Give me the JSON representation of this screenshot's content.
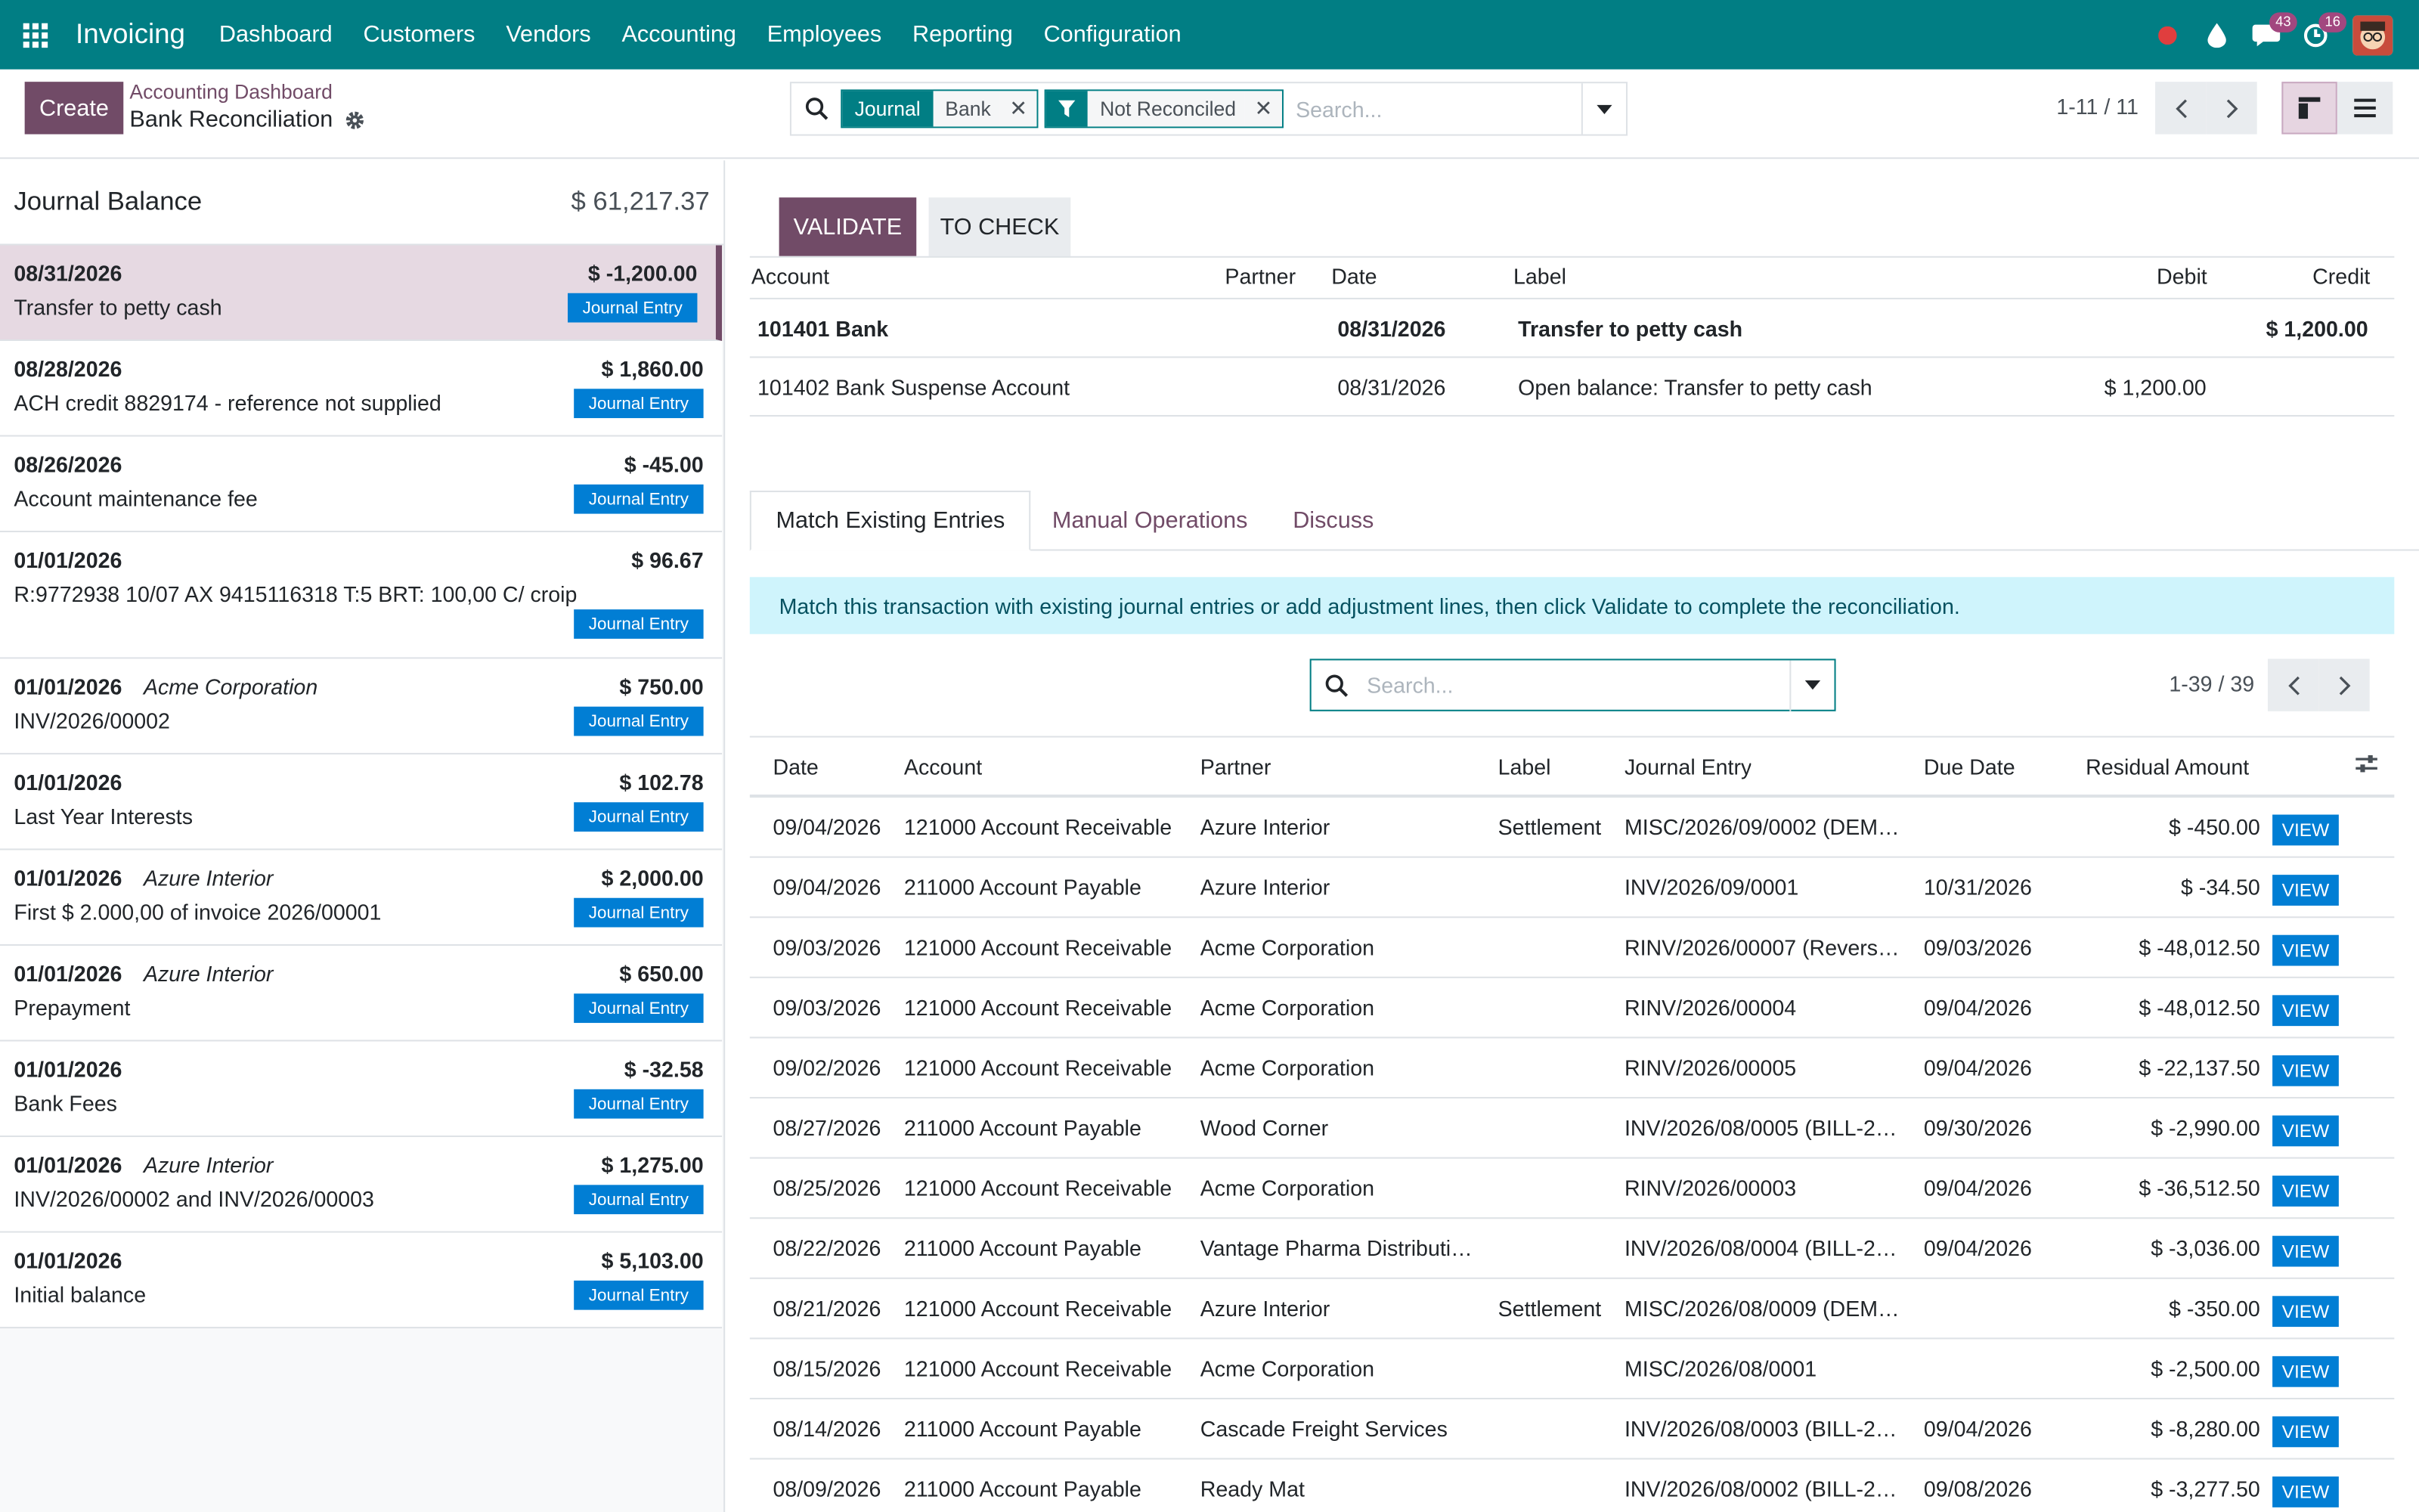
{
  "navbar": {
    "app_name": "Invoicing",
    "menu": [
      "Dashboard",
      "Customers",
      "Vendors",
      "Accounting",
      "Employees",
      "Reporting",
      "Configuration"
    ],
    "messages_count": "43",
    "activities_count": "16"
  },
  "control_panel": {
    "create_label": "Create",
    "breadcrumb_parent": "Accounting Dashboard",
    "breadcrumb_current": "Bank Reconciliation",
    "facets": [
      {
        "label": "Journal",
        "value": "Bank"
      },
      {
        "label": "filter-icon",
        "value": "Not Reconciled"
      }
    ],
    "search_placeholder": "Search...",
    "pager": "1-11 / 11"
  },
  "left_panel": {
    "balance_label": "Journal Balance",
    "balance_value": "$ 61,217.37",
    "badge_label": "Journal Entry",
    "lines": [
      {
        "date": "08/31/2026",
        "partner": "",
        "amount": "$ -1,200.00",
        "label": "Transfer to petty cash",
        "selected": true
      },
      {
        "date": "08/28/2026",
        "partner": "",
        "amount": "$ 1,860.00",
        "label": "ACH credit 8829174 - reference not supplied"
      },
      {
        "date": "08/26/2026",
        "partner": "",
        "amount": "$ -45.00",
        "label": "Account maintenance fee"
      },
      {
        "date": "01/01/2026",
        "partner": "",
        "amount": "$ 96.67",
        "label": "R:9772938 10/07 AX 9415116318 T:5 BRT: 100,00 C/ croip"
      },
      {
        "date": "01/01/2026",
        "partner": "Acme Corporation",
        "amount": "$ 750.00",
        "label": "INV/2026/00002"
      },
      {
        "date": "01/01/2026",
        "partner": "",
        "amount": "$ 102.78",
        "label": "Last Year Interests"
      },
      {
        "date": "01/01/2026",
        "partner": "Azure Interior",
        "amount": "$ 2,000.00",
        "label": "First $ 2.000,00 of invoice 2026/00001"
      },
      {
        "date": "01/01/2026",
        "partner": "Azure Interior",
        "amount": "$ 650.00",
        "label": "Prepayment"
      },
      {
        "date": "01/01/2026",
        "partner": "",
        "amount": "$ -32.58",
        "label": "Bank Fees"
      },
      {
        "date": "01/01/2026",
        "partner": "Azure Interior",
        "amount": "$ 1,275.00",
        "label": "INV/2026/00002 and INV/2026/00003"
      },
      {
        "date": "01/01/2026",
        "partner": "",
        "amount": "$ 5,103.00",
        "label": "Initial balance"
      }
    ]
  },
  "right_panel": {
    "validate_label": "VALIDATE",
    "tocheck_label": "TO CHECK",
    "entry_headers": {
      "account": "Account",
      "partner": "Partner",
      "date": "Date",
      "label": "Label",
      "debit": "Debit",
      "credit": "Credit"
    },
    "entry_rows": [
      {
        "account": "101401 Bank",
        "partner": "",
        "date": "08/31/2026",
        "label": "Transfer to petty cash",
        "debit": "",
        "credit": "$ 1,200.00",
        "bold": true
      },
      {
        "account": "101402 Bank Suspense Account",
        "partner": "",
        "date": "08/31/2026",
        "label": "Open balance: Transfer to petty cash",
        "debit": "$ 1,200.00",
        "credit": ""
      }
    ],
    "tabs": [
      "Match Existing Entries",
      "Manual Operations",
      "Discuss"
    ],
    "info_text": "Match this transaction with existing journal entries or add adjustment lines, then click Validate to complete the reconciliation.",
    "match_search_placeholder": "Search...",
    "match_pager": "1-39 / 39",
    "match_headers": {
      "date": "Date",
      "account": "Account",
      "partner": "Partner",
      "label": "Label",
      "journal_entry": "Journal Entry",
      "due_date": "Due Date",
      "residual": "Residual Amount"
    },
    "view_label": "VIEW",
    "match_rows": [
      {
        "date": "09/04/2026",
        "account": "121000 Account Receivable",
        "partner": "Azure Interior",
        "label": "Settlement",
        "entry": "MISC/2026/09/0002 (DEM…",
        "due": "",
        "residual": "$ -450.00"
      },
      {
        "date": "09/04/2026",
        "account": "211000 Account Payable",
        "partner": "Azure Interior",
        "label": "",
        "entry": "INV/2026/09/0001",
        "due": "10/31/2026",
        "residual": "$ -34.50"
      },
      {
        "date": "09/03/2026",
        "account": "121000 Account Receivable",
        "partner": "Acme Corporation",
        "label": "",
        "entry": "RINV/2026/00007 (Revers…",
        "due": "09/03/2026",
        "residual": "$ -48,012.50"
      },
      {
        "date": "09/03/2026",
        "account": "121000 Account Receivable",
        "partner": "Acme Corporation",
        "label": "",
        "entry": "RINV/2026/00004",
        "due": "09/04/2026",
        "residual": "$ -48,012.50"
      },
      {
        "date": "09/02/2026",
        "account": "121000 Account Receivable",
        "partner": "Acme Corporation",
        "label": "",
        "entry": "RINV/2026/00005",
        "due": "09/04/2026",
        "residual": "$ -22,137.50"
      },
      {
        "date": "08/27/2026",
        "account": "211000 Account Payable",
        "partner": "Wood Corner",
        "label": "",
        "entry": "INV/2026/08/0005 (BILL-2…",
        "due": "09/30/2026",
        "residual": "$ -2,990.00"
      },
      {
        "date": "08/25/2026",
        "account": "121000 Account Receivable",
        "partner": "Acme Corporation",
        "label": "",
        "entry": "RINV/2026/00003",
        "due": "09/04/2026",
        "residual": "$ -36,512.50"
      },
      {
        "date": "08/22/2026",
        "account": "211000 Account Payable",
        "partner": "Vantage Pharma Distributi…",
        "label": "",
        "entry": "INV/2026/08/0004 (BILL-2…",
        "due": "09/04/2026",
        "residual": "$ -3,036.00"
      },
      {
        "date": "08/21/2026",
        "account": "121000 Account Receivable",
        "partner": "Azure Interior",
        "label": "Settlement",
        "entry": "MISC/2026/08/0009 (DEM…",
        "due": "",
        "residual": "$ -350.00"
      },
      {
        "date": "08/15/2026",
        "account": "121000 Account Receivable",
        "partner": "Acme Corporation",
        "label": "",
        "entry": "MISC/2026/08/0001",
        "due": "",
        "residual": "$ -2,500.00"
      },
      {
        "date": "08/14/2026",
        "account": "211000 Account Payable",
        "partner": "Cascade Freight Services",
        "label": "",
        "entry": "INV/2026/08/0003 (BILL-2…",
        "due": "09/04/2026",
        "residual": "$ -8,280.00"
      },
      {
        "date": "08/09/2026",
        "account": "211000 Account Payable",
        "partner": "Ready Mat",
        "label": "",
        "entry": "INV/2026/08/0002 (BILL-2…",
        "due": "09/08/2026",
        "residual": "$ -3,277.50"
      }
    ]
  },
  "colors": {
    "brand": "#017e84",
    "accent": "#714b67",
    "badge": "#017ed4"
  }
}
